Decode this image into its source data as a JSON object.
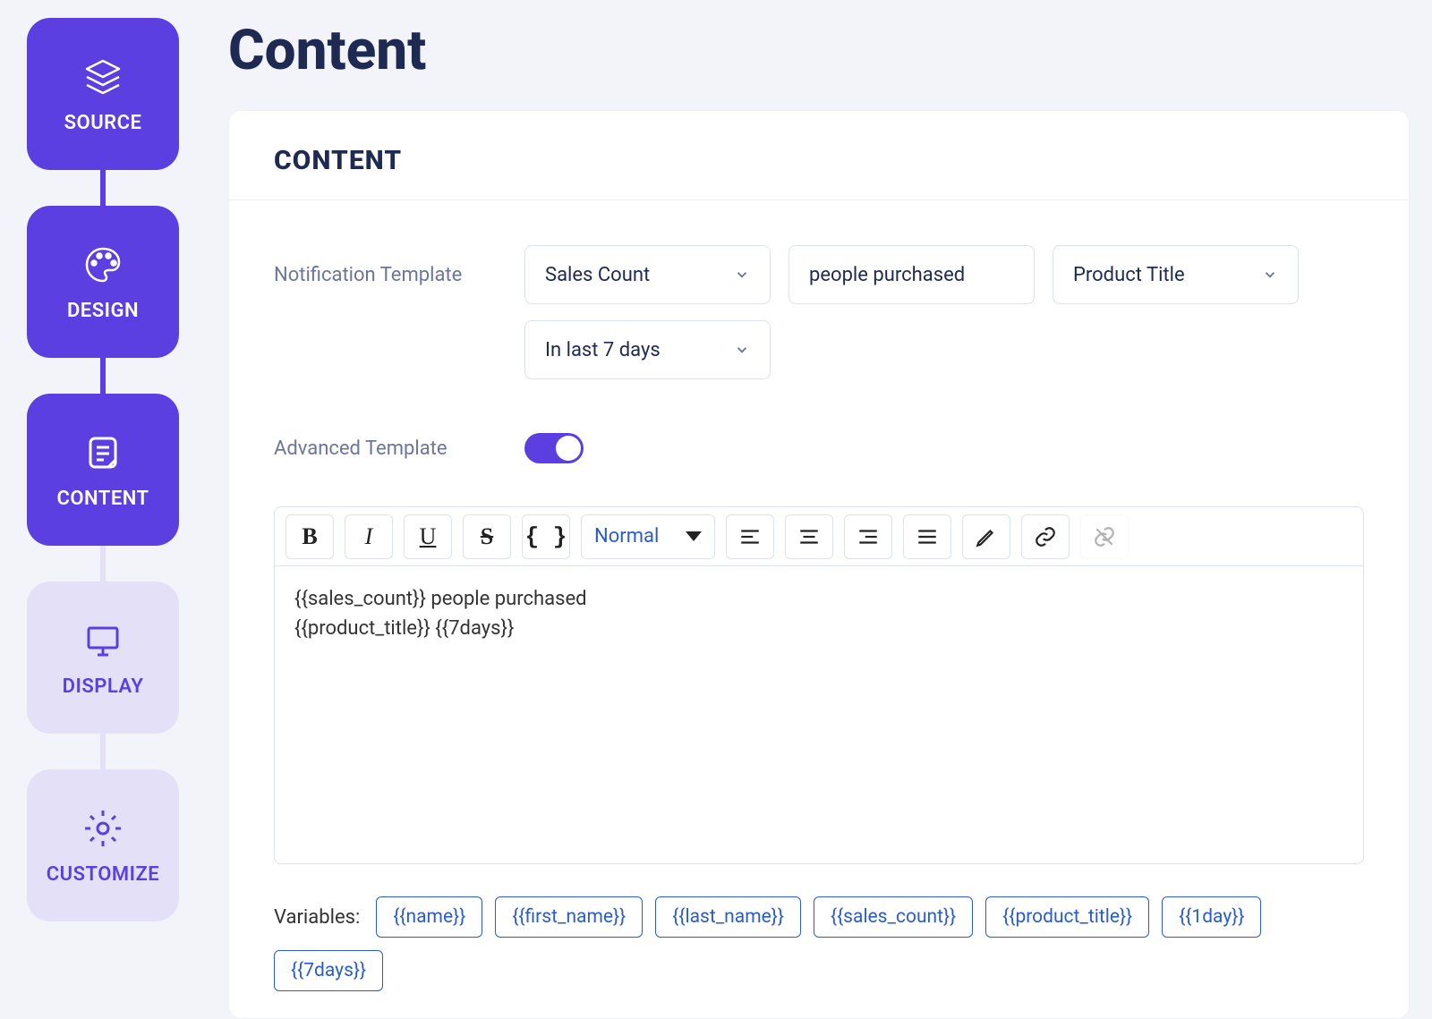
{
  "page": {
    "title": "Content"
  },
  "sidebar": {
    "steps": [
      {
        "label": "SOURCE",
        "active": true,
        "icon": "layers-icon"
      },
      {
        "label": "DESIGN",
        "active": true,
        "icon": "palette-icon"
      },
      {
        "label": "CONTENT",
        "active": true,
        "icon": "document-icon"
      },
      {
        "label": "DISPLAY",
        "active": false,
        "icon": "monitor-icon"
      },
      {
        "label": "CUSTOMIZE",
        "active": false,
        "icon": "gear-icon"
      }
    ]
  },
  "card": {
    "header": "CONTENT",
    "fields": {
      "notification_template_label": "Notification Template",
      "template_select": "Sales Count",
      "verb_text": "people purchased",
      "subject_select": "Product Title",
      "timeframe_select": "In last 7 days",
      "advanced_template_label": "Advanced Template",
      "advanced_template_on": true
    }
  },
  "editor": {
    "style_select": "Normal",
    "content_line1": "{{sales_count}} people purchased",
    "content_line2": "{{product_title}} {{7days}}"
  },
  "variables": {
    "label": "Variables:",
    "items": [
      "{{name}}",
      "{{first_name}}",
      "{{last_name}}",
      "{{sales_count}}",
      "{{product_title}}",
      "{{1day}}",
      "{{7days}}"
    ]
  }
}
